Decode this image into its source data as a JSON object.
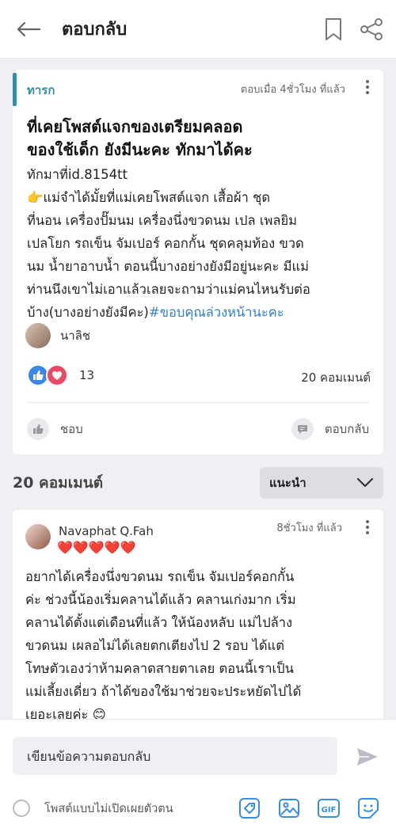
{
  "header": {
    "title": "ตอบกลับ",
    "back_icon": "arrow-left-icon",
    "bookmark_icon": "bookmark-icon",
    "share_icon": "share-icon"
  },
  "post": {
    "category": "ทารก",
    "time": "ตอบเมื่อ 4ชั่วโมง ที่แล้ว",
    "headline_lines": [
      "ที่เคยโพสต์แจกของเตรียมคลอด",
      "ของใช้เด็ก ยังมีนะคะ ทักมาได้คะ"
    ],
    "body_lines": [
      "ทักมาที่id.8154tt",
      "👉แม่จำได้มั้ยที่แม่เคยโพสต์แจก เสื้อผ้า ชุด",
      "ที่นอน เครื่องปั๊มนม เครื่องนึ่งขวดนม เปล เพลยิม",
      "เปลโยก รถเข็น จัมเปอร์ คอกกั้น ชุดคลุมท้อง ขวด",
      "นม น้ำยาอาบน้ำ ตอนนี้บางอย่างยังมีอยู่นะคะ มีแม่",
      "ท่านนึงเขาไม่เอาแล้วเลยจะถามว่าแม่คนไหนรับต่อ"
    ],
    "body_last_line": "บ้าง(บางอย่างยังมีคะ)",
    "hashtag": "#ขอบคุณล่วงหน้านะคะ",
    "author": "นาลิช",
    "reaction_count": "13",
    "comment_count": "20 คอมเมนต์",
    "like_label": "ชอบ",
    "reply_label": "ตอบกลับ"
  },
  "comments_header": {
    "count_label": "20 คอมเมนต์",
    "sort_label": "แนะนำ"
  },
  "comment": {
    "name": "Navaphat Q.Fah",
    "hearts": "❤️❤️❤️❤️❤️",
    "time": "8ชั่วโมง ที่แล้ว",
    "body_lines": [
      "อยากได้เครื่องนึ่งขวดนม รถเข็น จัมเปอร์คอกกั้น",
      "ค่ะ ช่วงนี้น้องเริ่มคลานได้แล้ว คลานเก่งมาก เริ่ม",
      "คลานได้ตั้งแต่เดือนที่แล้ว ให้น้องหลับ แม่ไปล้าง",
      "ขวดนม เผลอไม่ได้เลยตกเตียงไป 2 รอบ ได้แต่",
      "โทษตัวเองว่าห้ามคลาดสายตาเลย ตอนนี้เราเป็น",
      "แม่เลี้ยงเดี่ยว ถ้าได้ของใช้มาช่วยจะประหยัดไปได้",
      "เยอะเลยค่ะ 😊"
    ]
  },
  "composer": {
    "placeholder": "เขียนข้อความตอบกลับ",
    "anon_label": "โพสต์แบบไม่เปิดเผยตัวตน",
    "gif_label": "GIF"
  },
  "colors": {
    "accent": "#2e8fa8",
    "like_blue": "#3c86e6",
    "heart_red": "#ea4968",
    "hashtag_blue": "#2f7fd1",
    "tool_blue": "#3a8ee0"
  }
}
